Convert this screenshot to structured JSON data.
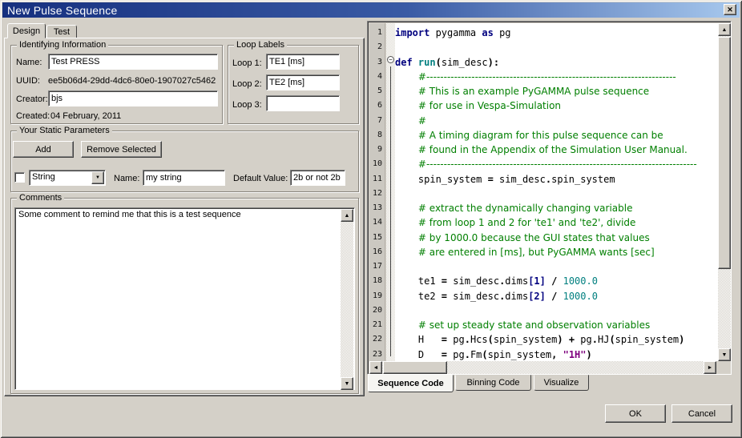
{
  "window": {
    "title": "New Pulse Sequence"
  },
  "icons": {
    "close": "✕",
    "up": "▲",
    "down": "▼",
    "left": "◄",
    "right": "►",
    "dropdown": "▼",
    "fold_collapse": "−"
  },
  "tabs": {
    "design": "Design",
    "test": "Test"
  },
  "identifying": {
    "legend": "Identifying Information",
    "name_label": "Name:",
    "name_value": "Test PRESS",
    "uuid_label": "UUID:",
    "uuid_value": "ee5b06d4-29dd-4dc6-80e0-1907027c5462",
    "creator_label": "Creator:",
    "creator_value": "bjs",
    "created_label": "Created:",
    "created_value": "04 February, 2011"
  },
  "loops": {
    "legend": "Loop Labels",
    "rows": [
      {
        "label": "Loop 1:",
        "value": "TE1 [ms]"
      },
      {
        "label": "Loop 2:",
        "value": "TE2 [ms]"
      },
      {
        "label": "Loop 3:",
        "value": ""
      }
    ]
  },
  "params": {
    "legend": "Your Static Parameters",
    "add_label": "Add",
    "remove_label": "Remove Selected",
    "type_value": "String",
    "name_label": "Name:",
    "name_value": "my string",
    "default_label": "Default Value:",
    "default_value": "2b or not 2b"
  },
  "comments": {
    "legend": "Comments",
    "text": "Some comment to remind me that this is a test sequence"
  },
  "editor": {
    "fold_line": 3,
    "lines": [
      [
        [
          "k",
          "import"
        ],
        [
          "p",
          " pygamma "
        ],
        [
          "k",
          "as"
        ],
        [
          "p",
          " pg"
        ]
      ],
      [],
      [
        [
          "k",
          "def"
        ],
        [
          "p",
          " "
        ],
        [
          "d",
          "run"
        ],
        [
          "o",
          "("
        ],
        [
          "p",
          "sim_desc"
        ],
        [
          "o",
          "):"
        ]
      ],
      [
        [
          "p",
          "    "
        ],
        [
          "c",
          "#------------------------------------------------------------------------"
        ]
      ],
      [
        [
          "p",
          "    "
        ],
        [
          "c",
          "# This is an example PyGAMMA pulse sequence"
        ]
      ],
      [
        [
          "p",
          "    "
        ],
        [
          "c",
          "# for use in Vespa-Simulation"
        ]
      ],
      [
        [
          "p",
          "    "
        ],
        [
          "c",
          "#"
        ]
      ],
      [
        [
          "p",
          "    "
        ],
        [
          "c",
          "# A timing diagram for this pulse sequence can be"
        ]
      ],
      [
        [
          "p",
          "    "
        ],
        [
          "c",
          "# found in the Appendix of the Simulation User Manual."
        ]
      ],
      [
        [
          "p",
          "    "
        ],
        [
          "c",
          "#------------------------------------------------------------------------------"
        ]
      ],
      [
        [
          "p",
          "    spin_system "
        ],
        [
          "o",
          "="
        ],
        [
          "p",
          " sim_desc"
        ],
        [
          "o",
          "."
        ],
        [
          "p",
          "spin_system"
        ]
      ],
      [],
      [
        [
          "p",
          "    "
        ],
        [
          "c",
          "# extract the dynamically changing variable"
        ]
      ],
      [
        [
          "p",
          "    "
        ],
        [
          "c",
          "# from loop 1 and 2 for 'te1' and 'te2', divide"
        ]
      ],
      [
        [
          "p",
          "    "
        ],
        [
          "c",
          "# by 1000.0 because the GUI states that values"
        ]
      ],
      [
        [
          "p",
          "    "
        ],
        [
          "c",
          "# are entered in [ms], but PyGAMMA wants [sec]"
        ]
      ],
      [],
      [
        [
          "p",
          "    te1 "
        ],
        [
          "o",
          "="
        ],
        [
          "p",
          " sim_desc"
        ],
        [
          "o",
          "."
        ],
        [
          "p",
          "dims"
        ],
        [
          "b",
          "[1]"
        ],
        [
          "p",
          " "
        ],
        [
          "o",
          "/"
        ],
        [
          "p",
          " "
        ],
        [
          "n",
          "1000.0"
        ]
      ],
      [
        [
          "p",
          "    te2 "
        ],
        [
          "o",
          "="
        ],
        [
          "p",
          " sim_desc"
        ],
        [
          "o",
          "."
        ],
        [
          "p",
          "dims"
        ],
        [
          "b",
          "[2]"
        ],
        [
          "p",
          " "
        ],
        [
          "o",
          "/"
        ],
        [
          "p",
          " "
        ],
        [
          "n",
          "1000.0"
        ]
      ],
      [],
      [
        [
          "p",
          "    "
        ],
        [
          "c",
          "# set up steady state and observation variables"
        ]
      ],
      [
        [
          "p",
          "    H   "
        ],
        [
          "o",
          "="
        ],
        [
          "p",
          " pg"
        ],
        [
          "o",
          "."
        ],
        [
          "p",
          "Hcs"
        ],
        [
          "o",
          "("
        ],
        [
          "p",
          "spin_system"
        ],
        [
          "o",
          ")"
        ],
        [
          "p",
          " "
        ],
        [
          "o",
          "+"
        ],
        [
          "p",
          " pg"
        ],
        [
          "o",
          "."
        ],
        [
          "p",
          "HJ"
        ],
        [
          "o",
          "("
        ],
        [
          "p",
          "spin_system"
        ],
        [
          "o",
          ")"
        ]
      ],
      [
        [
          "p",
          "    D   "
        ],
        [
          "o",
          "="
        ],
        [
          "p",
          " pg"
        ],
        [
          "o",
          "."
        ],
        [
          "p",
          "Fm"
        ],
        [
          "o",
          "("
        ],
        [
          "p",
          "spin_system"
        ],
        [
          "o",
          ","
        ],
        [
          "p",
          " "
        ],
        [
          "s",
          "\"1H\""
        ],
        [
          "o",
          ")"
        ]
      ]
    ]
  },
  "bottom_tabs": [
    {
      "label": "Sequence Code",
      "selected": true
    },
    {
      "label": "Binning Code",
      "selected": false
    },
    {
      "label": "Visualize",
      "selected": false
    }
  ],
  "actions": {
    "ok": "OK",
    "cancel": "Cancel"
  },
  "colors": {
    "titlebar_left": "#16307f",
    "titlebar_right": "#a8c9ee",
    "face": "#d4d0c8",
    "keyword": "#00007f",
    "comment": "#007f00",
    "number": "#007f7f",
    "string": "#7f007f",
    "defname": "#007f7f"
  }
}
